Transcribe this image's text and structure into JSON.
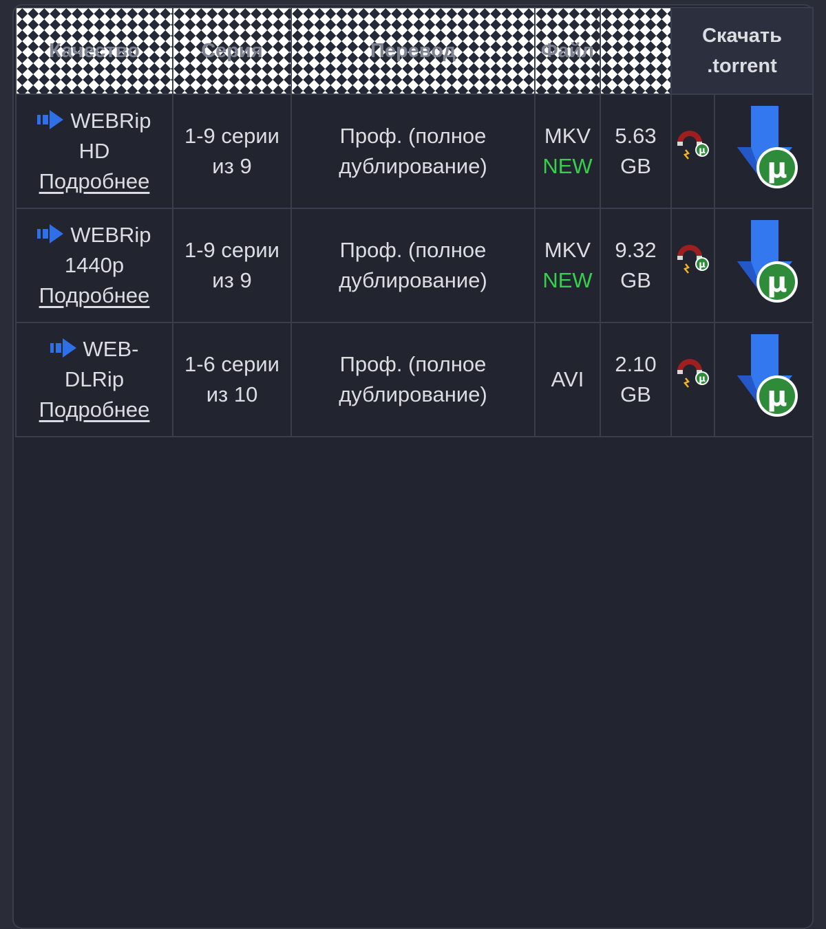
{
  "header": {
    "col_quality": "Качество",
    "col_series": "Серия",
    "col_translation": "Перевод",
    "col_file": "Файл",
    "col_download_line1": "Скачать",
    "col_download_line2": ".torrent"
  },
  "colors": {
    "background": "#22252f",
    "border": "#3a3e4c",
    "arrow_blue": "#2f6fe8",
    "new_green": "#36d04d",
    "utorrent_green": "#2e8b3a"
  },
  "rows": [
    {
      "quality_line1": "WEBRip",
      "quality_line2": "HD",
      "more": "Подробнее",
      "series_line1": "1-9 серии",
      "series_line2": "из 9",
      "translation_line1": "Проф. (полное",
      "translation_line2": "дублирование)",
      "format": "MKV",
      "badge": "NEW",
      "size_value": "5.63",
      "size_unit": "GB"
    },
    {
      "quality_line1": "WEBRip",
      "quality_line2": "1440p",
      "more": "Подробнее",
      "series_line1": "1-9 серии",
      "series_line2": "из 9",
      "translation_line1": "Проф. (полное",
      "translation_line2": "дублирование)",
      "format": "MKV",
      "badge": "NEW",
      "size_value": "9.32",
      "size_unit": "GB"
    },
    {
      "quality_line1": "WEB-",
      "quality_line2": "DLRip",
      "more": "Подробнее",
      "series_line1": "1-6 серии",
      "series_line2": "из 10",
      "translation_line1": "Проф. (полное",
      "translation_line2": "дублирование)",
      "format": "AVI",
      "badge": "",
      "size_value": "2.10",
      "size_unit": "GB"
    }
  ],
  "icons": {
    "quality_arrow": "arrow-right-icon",
    "magnet": "magnet-utorrent-icon",
    "download": "download-torrent-icon"
  }
}
